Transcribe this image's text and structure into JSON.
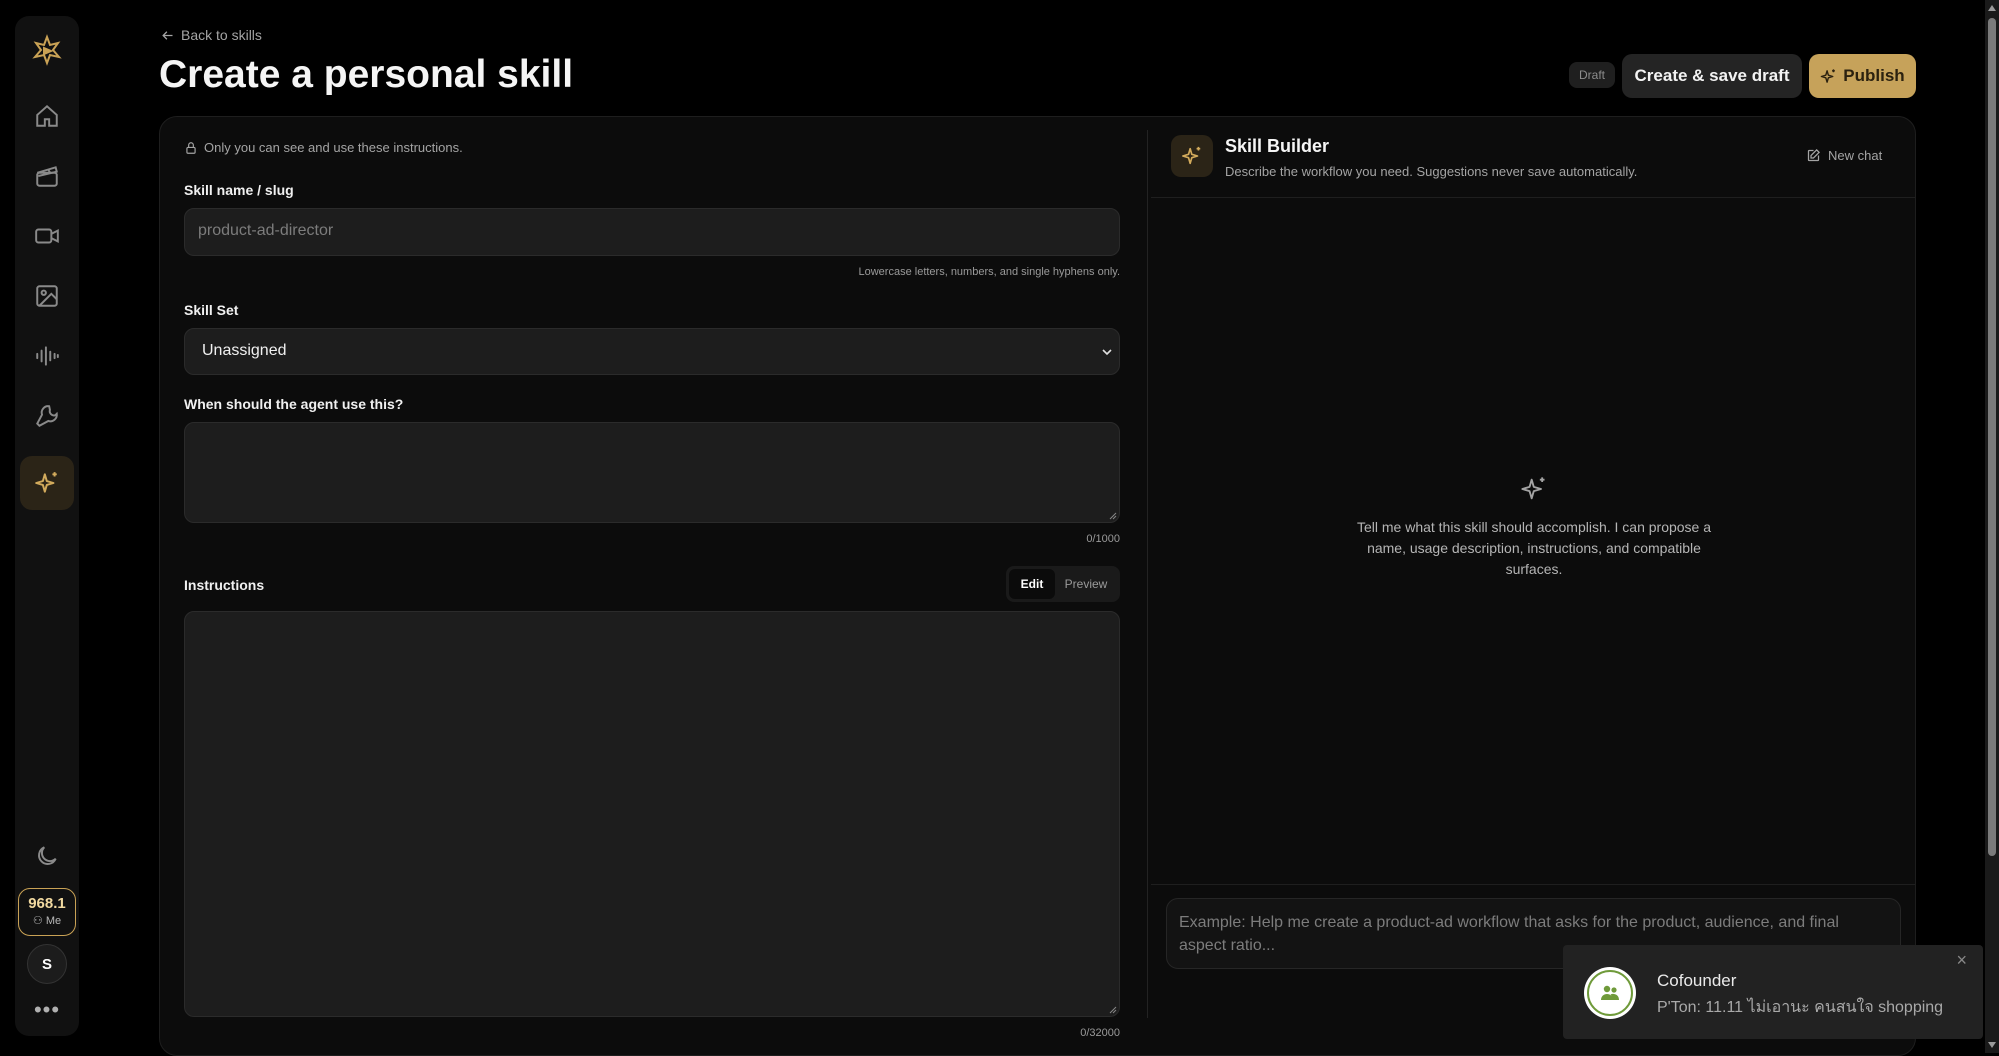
{
  "nav": {
    "back_label": "Back to skills",
    "items": [
      "home-icon",
      "clapperboard-icon",
      "video-camera-icon",
      "image-icon",
      "audio-waveform-icon",
      "wrench-icon",
      "sparkles-icon"
    ],
    "credits": "968.1",
    "account_label": "Me",
    "avatar_initial": "S"
  },
  "page": {
    "title": "Create a personal skill",
    "status_badge": "Draft",
    "save_button": "Create & save draft",
    "publish_button": "Publish"
  },
  "form": {
    "privacy_note": "Only you can see and use these instructions.",
    "name_label": "Skill name / slug",
    "name_placeholder": "product-ad-director",
    "name_hint": "Lowercase letters, numbers, and single hyphens only.",
    "skillset_label": "Skill Set",
    "skillset_value": "Unassigned",
    "when_label": "When should the agent use this?",
    "when_counter": "0/1000",
    "instructions_label": "Instructions",
    "tab_edit": "Edit",
    "tab_preview": "Preview",
    "instructions_counter": "0/32000"
  },
  "builder": {
    "title": "Skill Builder",
    "subtitle": "Describe the workflow you need. Suggestions never save automatically.",
    "new_chat": "New chat",
    "empty_text": "Tell me what this skill should accomplish. I can propose a name, usage description, instructions, and compatible surfaces.",
    "input_placeholder": "Example: Help me create a product-ad workflow that asks for the product, audience, and final aspect ratio..."
  },
  "notification": {
    "title": "Cofounder",
    "message": "P'Ton: 11.11 ไม่เอานะ คนสนใจ shopping",
    "close": "×"
  },
  "colors": {
    "accent": "#c6a25a",
    "background": "#000000",
    "panel": "#0c0c0c",
    "field": "#1d1d1d"
  }
}
